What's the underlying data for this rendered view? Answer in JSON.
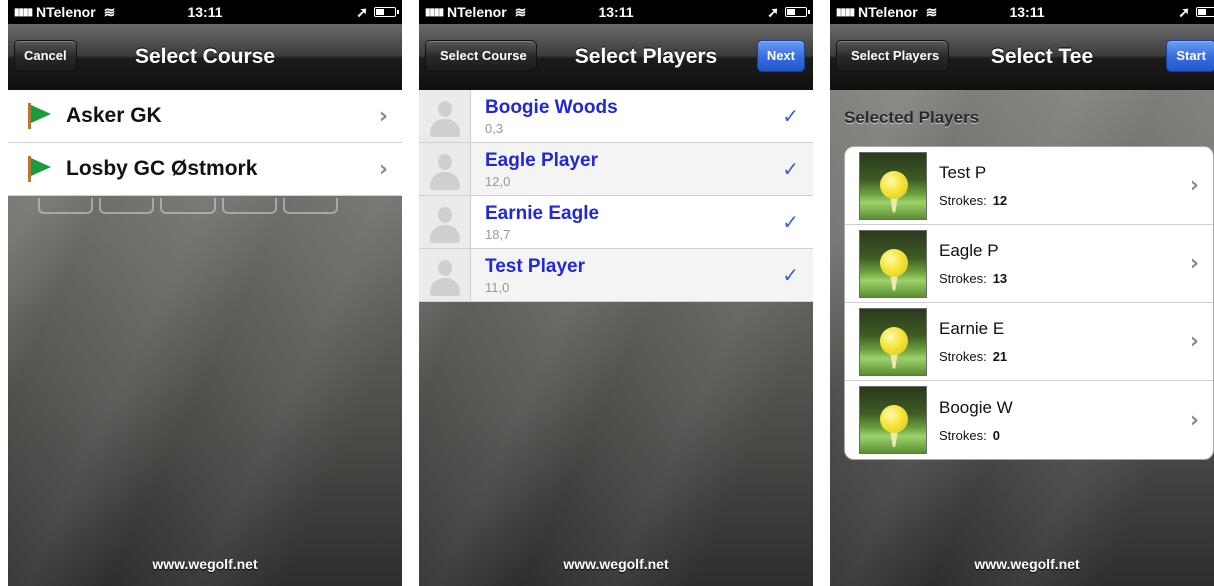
{
  "status": {
    "carrier": "NTelenor",
    "time": "13:11",
    "battery_level": 0.4
  },
  "screen1": {
    "nav": {
      "title": "Select Course",
      "left_button": "Cancel"
    },
    "courses": [
      {
        "name": "Asker GK",
        "icon": "flag-icon"
      },
      {
        "name": "Losby GC Østmork",
        "icon": "flag-icon"
      }
    ],
    "footer": "www.wegolf.net"
  },
  "screen2": {
    "nav": {
      "title": "Select Players",
      "back_button": "Select Course",
      "right_button": "Next"
    },
    "players": [
      {
        "name": "Boogie Woods",
        "hcp": "0,3",
        "checked": true
      },
      {
        "name": "Eagle Player",
        "hcp": "12,0",
        "checked": true
      },
      {
        "name": "Earnie Eagle",
        "hcp": "18,7",
        "checked": true
      },
      {
        "name": "Test Player",
        "hcp": "11,0",
        "checked": true
      }
    ],
    "footer": "www.wegolf.net"
  },
  "screen3": {
    "nav": {
      "title": "Select Tee",
      "back_button": "Select Players",
      "right_button": "Start"
    },
    "section_header": "Selected Players",
    "strokes_label": "Strokes:",
    "selected": [
      {
        "name": "Test P",
        "strokes": "12"
      },
      {
        "name": "Eagle P",
        "strokes": "13"
      },
      {
        "name": "Earnie E",
        "strokes": "21"
      },
      {
        "name": "Boogie W",
        "strokes": "0"
      }
    ],
    "footer": "www.wegolf.net"
  },
  "colors": {
    "accent_blue": "#2157cf",
    "player_name_blue": "#2128d6",
    "checkmark_blue": "#3a63c9",
    "flag_green": "#1b9c3a"
  }
}
